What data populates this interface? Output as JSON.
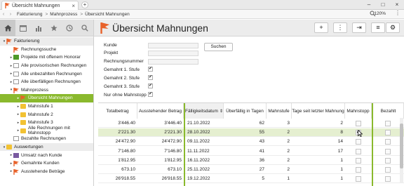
{
  "window": {
    "tab_title": "Übersicht Mahnungen",
    "tab_close": "×",
    "new_tab": "+",
    "minimize": "–",
    "maximize": "□",
    "close": "×",
    "nav_back": "‹",
    "nav_forward": "›",
    "breadcrumb": [
      "Fakturierung",
      "Mahnprozess",
      "Übersicht Mahnungen"
    ],
    "breadcrumb_sep": ">",
    "zoom": "120%",
    "menu": "⋮"
  },
  "sidebar": {
    "items": [
      {
        "label": "Fakturierung",
        "level": 0,
        "arrow": "▾",
        "icon": "invoice-icon",
        "group": true
      },
      {
        "label": "Rechnungssuche",
        "level": 1,
        "arrow": "",
        "icon": "invoice-icon"
      },
      {
        "label": "Projekte mit offenem Honorar",
        "level": 1,
        "arrow": "▸",
        "icon": "project-icon"
      },
      {
        "label": "Alle provisorischen Rechnungen",
        "level": 1,
        "arrow": "▸",
        "icon": "document-icon"
      },
      {
        "label": "Alle unbezahlten Rechnungen",
        "level": 1,
        "arrow": "▸",
        "icon": "document-icon"
      },
      {
        "label": "Alle überfälligen Rechnungen",
        "level": 1,
        "arrow": "▸",
        "icon": "document-icon"
      },
      {
        "label": "Mahnprozess",
        "level": 1,
        "arrow": "▾",
        "icon": "flag-icon"
      },
      {
        "label": "Übersicht Mahnungen",
        "level": 2,
        "arrow": "▸",
        "icon": "flag-icon",
        "selected": true
      },
      {
        "label": "Mahnstufe 1",
        "level": 2,
        "arrow": "▸",
        "icon": "folder-icon"
      },
      {
        "label": "Mahnstufe 2",
        "level": 2,
        "arrow": "▸",
        "icon": "folder-icon"
      },
      {
        "label": "Mahnstufe 3",
        "level": 2,
        "arrow": "▸",
        "icon": "folder-icon"
      },
      {
        "label": "Alle Rechnungen mit Mahnstopp",
        "level": 2,
        "arrow": "▸",
        "icon": "folder-icon"
      },
      {
        "label": "Bezahlte Rechnungen",
        "level": 1,
        "arrow": "",
        "icon": "document-icon"
      },
      {
        "label": "Auswertungen",
        "level": 0,
        "arrow": "▾",
        "icon": "folder-icon",
        "group": true
      },
      {
        "label": "Umsatz nach Kunde",
        "level": 1,
        "arrow": "▸",
        "icon": "chart-icon"
      },
      {
        "label": "Gemahnte Kunden",
        "level": 1,
        "arrow": "▸",
        "icon": "flag-icon"
      },
      {
        "label": "Ausstehende Beträge",
        "level": 1,
        "arrow": "▸",
        "icon": "invoice-icon"
      }
    ]
  },
  "header": {
    "title": "Übersicht Mahnungen",
    "add": "+",
    "more": "⋮",
    "export": "⇥",
    "list": "≡",
    "settings": "⚙"
  },
  "filters": {
    "labels": [
      "Kunde",
      "Projekt",
      "Rechnungsnummer"
    ],
    "checks": [
      {
        "label": "Gemahnt 1. Stufe",
        "checked": "✔"
      },
      {
        "label": "Gemahnt 2. Stufe",
        "checked": "✔"
      },
      {
        "label": "Gemahnt 3. Stufe",
        "checked": "✔"
      },
      {
        "label": "Nur ohne Mahnstopp",
        "checked": "✔"
      }
    ],
    "search_button": "Suchen"
  },
  "table": {
    "columns": [
      "Totalbetrag",
      "Ausstehender Betrag",
      "Fälligkeitsdatum",
      "Überfällig in Tagen",
      "Mahnstufe",
      "Tage seit letzter Mahnung",
      "Mahnstopp",
      "Bezahlt"
    ],
    "sort_indicator": "⇕",
    "rows": [
      {
        "total": "3'446.40",
        "outstanding": "3'446.40",
        "due": "21.10.2022",
        "overdue": "62",
        "level": "3",
        "since": "2",
        "stop": "",
        "paid": ""
      },
      {
        "total": "2'221.30",
        "outstanding": "2'221.30",
        "due": "28.10.2022",
        "overdue": "55",
        "level": "2",
        "since": "8",
        "stop": "✔",
        "paid": "",
        "selected": true
      },
      {
        "total": "24'472.90",
        "outstanding": "24'472.90",
        "due": "09.11.2022",
        "overdue": "43",
        "level": "2",
        "since": "14",
        "stop": "",
        "paid": ""
      },
      {
        "total": "7'146.80",
        "outstanding": "7'146.80",
        "due": "11.11.2022",
        "overdue": "41",
        "level": "2",
        "since": "17",
        "stop": "",
        "paid": ""
      },
      {
        "total": "1'812.95",
        "outstanding": "1'812.95",
        "due": "16.11.2022",
        "overdue": "36",
        "level": "2",
        "since": "1",
        "stop": "",
        "paid": ""
      },
      {
        "total": "673.10",
        "outstanding": "673.10",
        "due": "25.11.2022",
        "overdue": "27",
        "level": "2",
        "since": "1",
        "stop": "",
        "paid": ""
      },
      {
        "total": "26'918.55",
        "outstanding": "26'918.55",
        "due": "19.12.2022",
        "overdue": "5",
        "level": "1",
        "since": "1",
        "stop": "",
        "paid": ""
      }
    ]
  },
  "colors": {
    "accent_green": "#8ab92d",
    "selected_row": "#e5efd0",
    "flag_orange": "#e8622a"
  }
}
